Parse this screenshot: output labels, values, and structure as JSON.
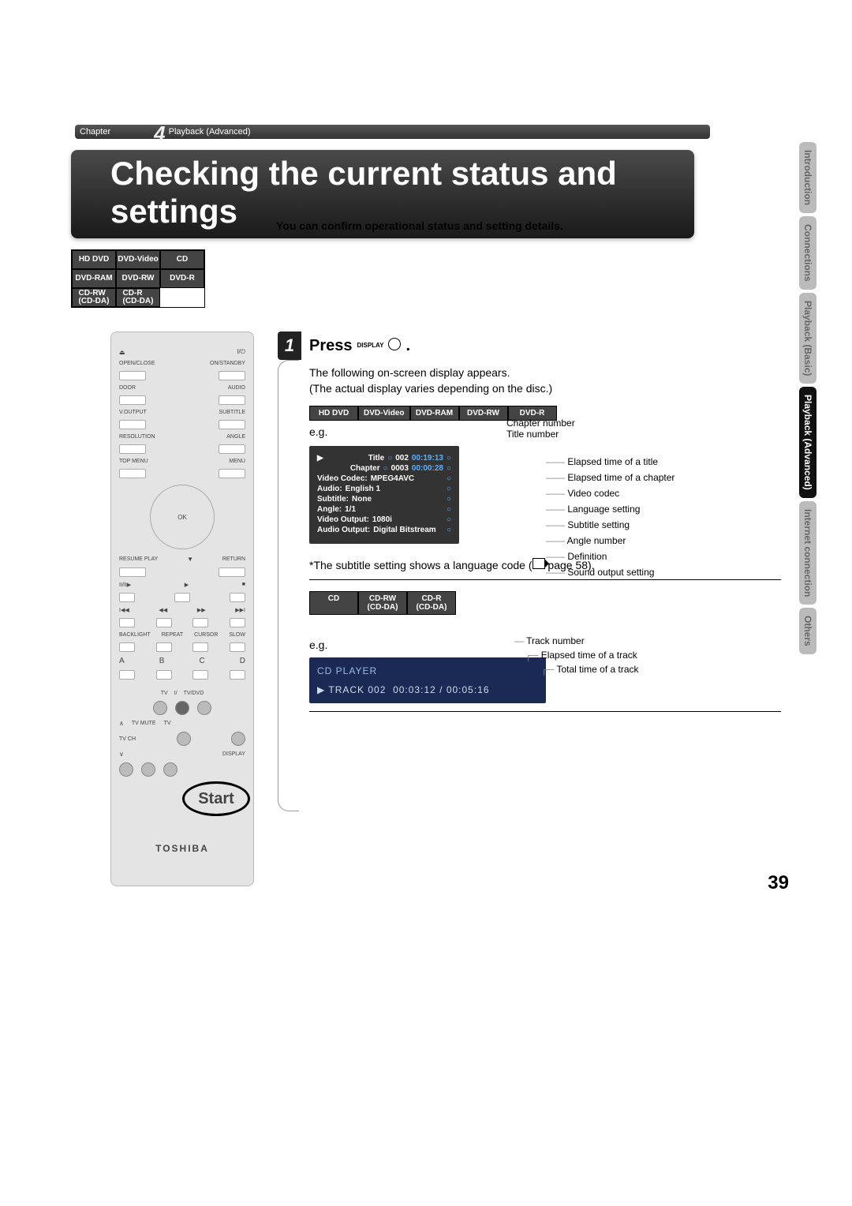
{
  "chapter": {
    "label": "Chapter",
    "num": "4",
    "section": "Playback (Advanced)"
  },
  "title": "Checking the current status and settings",
  "tabs": [
    "Introduction",
    "Connections",
    "Playback\n(Basic)",
    "Playback\n(Advanced)",
    "Internet\nconnection",
    "Others"
  ],
  "active_tab_index": 3,
  "disc_types": [
    [
      "HD DVD",
      "DVD-Video",
      "CD"
    ],
    [
      "DVD-RAM",
      "DVD-RW",
      "DVD-R"
    ],
    [
      "CD-RW\n(CD-DA)",
      "CD-R\n(CD-DA)"
    ]
  ],
  "intro": "You can confirm operational status and setting details.",
  "step": {
    "num": "1",
    "press": "Press",
    "display_label": "DISPLAY",
    "dot": ".",
    "line1": "The following on-screen display appears.",
    "line2": "(The actual display varies depending on the disc.)"
  },
  "fmt_video": [
    "HD DVD",
    "DVD-Video",
    "DVD-RAM",
    "DVD-RW",
    "DVD-R"
  ],
  "eg": "e.g.",
  "osd1_top_labels": [
    "Chapter number",
    "Title number"
  ],
  "osd1": {
    "title_lbl": "Title",
    "title_num": "002",
    "title_time": "00:19:13",
    "ch_lbl": "Chapter",
    "ch_num": "0003",
    "ch_time": "00:00:28",
    "rows": [
      {
        "k": "Video Codec:",
        "v": "MPEG4AVC"
      },
      {
        "k": "Audio:",
        "v": "English 1"
      },
      {
        "k": "Subtitle:",
        "v": "None"
      },
      {
        "k": "Angle:",
        "v": "1/1"
      },
      {
        "k": "Video Output:",
        "v": "1080i"
      },
      {
        "k": "Audio Output:",
        "v": "Digital Bitstream"
      }
    ]
  },
  "osd1_right": [
    "Elapsed time of a title",
    "Elapsed time of a chapter",
    "Video codec",
    "Language setting",
    "Subtitle setting",
    "Angle number",
    "Definition",
    "Sound output setting"
  ],
  "subtitle_note_pre": "*The subtitle setting shows a language code (",
  "subtitle_note_post": " page 58).",
  "fmt_audio": [
    "CD",
    "CD-RW\n(CD-DA)",
    "CD-R\n(CD-DA)"
  ],
  "osd2_top": [
    "Track number",
    "Elapsed time of a track",
    "Total time of a track"
  ],
  "osd2": {
    "hdr": "CD PLAYER",
    "trk_lbl": "TRACK",
    "trk_num": "002",
    "t1": "00:03:12",
    "sep": "/",
    "t2": "00:05:16"
  },
  "remote": {
    "rows1": [
      [
        "OPEN/CLOSE",
        "ON/STANDBY"
      ],
      [
        "DOOR",
        "AUDIO"
      ],
      [
        "V.OUTPUT",
        "SUBTITLE"
      ],
      [
        "RESOLUTION",
        "ANGLE"
      ],
      [
        "TOP MENU",
        "MENU"
      ]
    ],
    "ok": "OK",
    "rows2": [
      [
        "RESUME PLAY",
        "RETURN"
      ]
    ],
    "abcd": [
      "A",
      "B",
      "C",
      "D"
    ],
    "bottom_labels": [
      "BACKLIGHT",
      "REPEAT",
      "CURSOR",
      "SLOW"
    ],
    "tv": [
      "I/",
      "TV/DVD"
    ],
    "tv2": [
      "TV MUTE",
      "TV"
    ],
    "tvch": "TV CH",
    "display": "DISPLAY",
    "start": "Start",
    "brand": "TOSHIBA",
    "tv_lbl": "TV"
  },
  "page_num": "39"
}
